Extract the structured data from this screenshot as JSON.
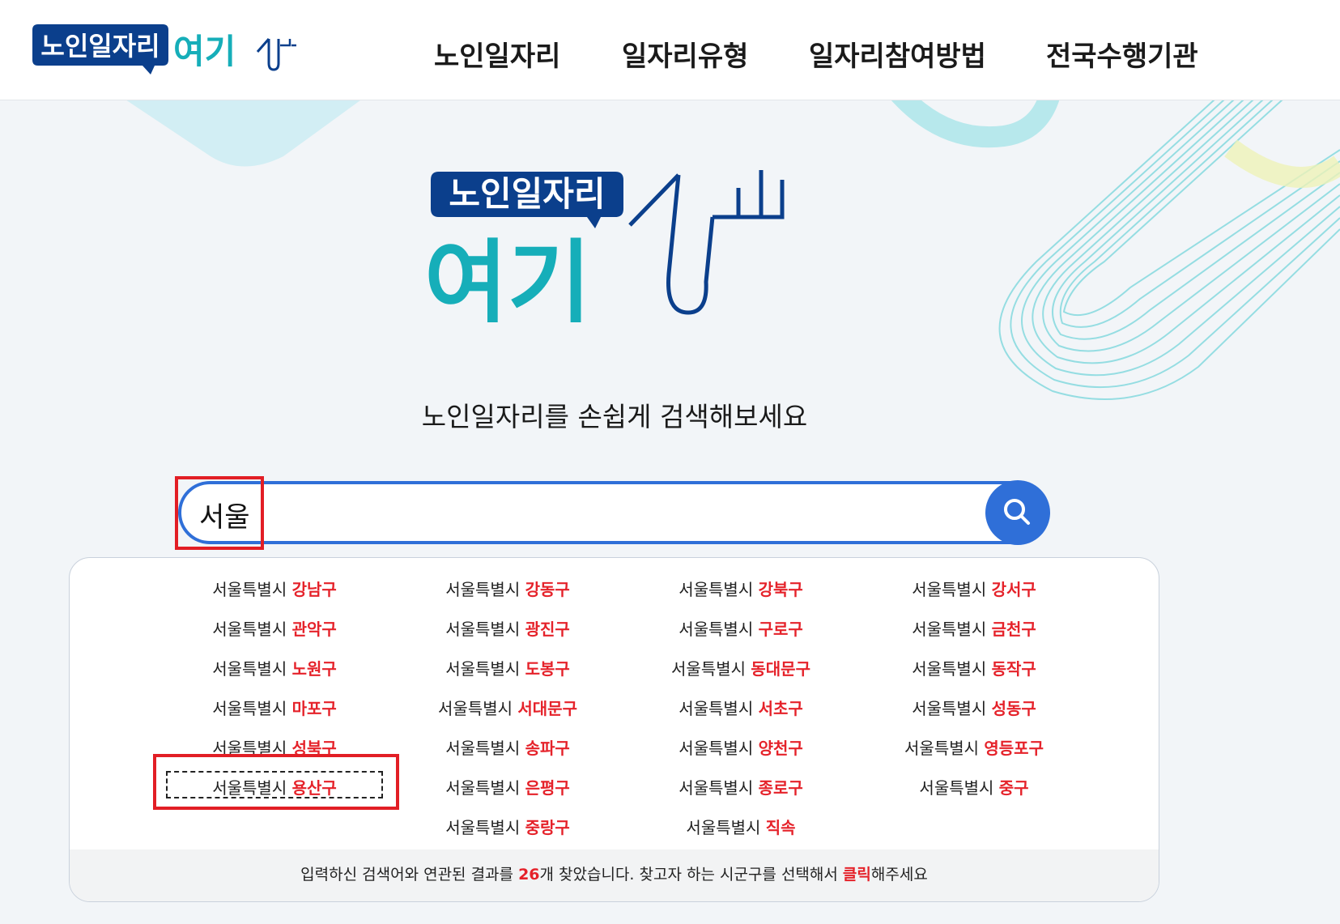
{
  "header": {
    "logo": {
      "line1": "노인일자리",
      "line2": "여기"
    },
    "nav": [
      {
        "label": "노인일자리"
      },
      {
        "label": "일자리유형"
      },
      {
        "label": "일자리참여방법"
      },
      {
        "label": "전국수행기관"
      }
    ]
  },
  "hero": {
    "logo": {
      "line1": "노인일자리",
      "line2": "여기"
    },
    "tagline": "노인일자리를 손쉽게 검색해보세요"
  },
  "search": {
    "value": "서울",
    "button_icon": "search-icon"
  },
  "results": {
    "items": [
      {
        "city": "서울특별시",
        "district": "강남구"
      },
      {
        "city": "서울특별시",
        "district": "강동구"
      },
      {
        "city": "서울특별시",
        "district": "강북구"
      },
      {
        "city": "서울특별시",
        "district": "강서구"
      },
      {
        "city": "서울특별시",
        "district": "관악구"
      },
      {
        "city": "서울특별시",
        "district": "광진구"
      },
      {
        "city": "서울특별시",
        "district": "구로구"
      },
      {
        "city": "서울특별시",
        "district": "금천구"
      },
      {
        "city": "서울특별시",
        "district": "노원구"
      },
      {
        "city": "서울특별시",
        "district": "도봉구"
      },
      {
        "city": "서울특별시",
        "district": "동대문구"
      },
      {
        "city": "서울특별시",
        "district": "동작구"
      },
      {
        "city": "서울특별시",
        "district": "마포구"
      },
      {
        "city": "서울특별시",
        "district": "서대문구"
      },
      {
        "city": "서울특별시",
        "district": "서초구"
      },
      {
        "city": "서울특별시",
        "district": "성동구"
      },
      {
        "city": "서울특별시",
        "district": "성북구"
      },
      {
        "city": "서울특별시",
        "district": "송파구"
      },
      {
        "city": "서울특별시",
        "district": "양천구"
      },
      {
        "city": "서울특별시",
        "district": "영등포구"
      },
      {
        "city": "서울특별시",
        "district": "용산구"
      },
      {
        "city": "서울특별시",
        "district": "은평구"
      },
      {
        "city": "서울특별시",
        "district": "종로구"
      },
      {
        "city": "서울특별시",
        "district": "중구"
      },
      {
        "city": "서울특별시",
        "district": "중랑구"
      },
      {
        "city": "서울특별시",
        "district": "직속"
      }
    ],
    "focused_district": "용산구",
    "footer": {
      "prefix": "입력하신 검색어와 연관된 결과를 ",
      "count": "26",
      "middle": "개 찾았습니다. 찾고자 하는 시군구를 선택해서 ",
      "click": "클릭",
      "suffix": "해주세요"
    }
  },
  "colors": {
    "accent": "#2f6fd8",
    "highlight": "#e5222a",
    "logo_navy": "#0b3f8c",
    "logo_teal": "#16aeb9",
    "annotation_red": "#e21e25"
  }
}
